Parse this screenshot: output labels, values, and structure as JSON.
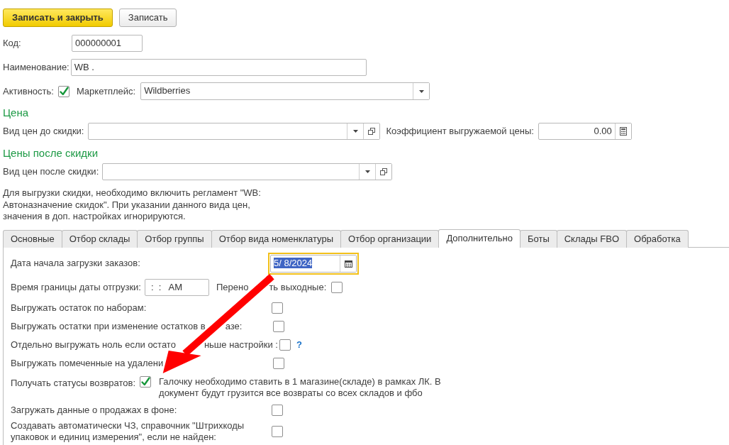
{
  "toolbar": {
    "buttons": [
      {
        "label": "Записать и закрыть",
        "kind": "primary"
      },
      {
        "label": "Записать",
        "kind": "default"
      }
    ]
  },
  "header": {
    "code": {
      "label": "Код:",
      "value": "000000001"
    },
    "name": {
      "label": "Наименование:",
      "value": "WB ."
    },
    "active": {
      "label": "Активность:",
      "checked": true
    },
    "marketplace": {
      "label": "Маркетплейс:",
      "value": "Wildberries"
    }
  },
  "price": {
    "title": "Цена",
    "price_type": {
      "label": "Вид цен до скидки:"
    },
    "coefficient": {
      "label": "Коэффициент выгружаемой цены:",
      "value": "0.00"
    }
  },
  "discount_price": {
    "title": "Цены после скидки",
    "price_type": {
      "label": "Вид цен после скидки:"
    },
    "note": "Для выгрузки скидки, необходимо включить регламент \"WB: Автоназначение скидок\". При указании данного вида цен, значения в доп. настройках игнорируются."
  },
  "tabs": [
    {
      "label": "Основные",
      "selected": false
    },
    {
      "label": "Отбор склады",
      "selected": false
    },
    {
      "label": "Отбор группы",
      "selected": false
    },
    {
      "label": "Отбор вида номенклатуры",
      "selected": false
    },
    {
      "label": "Отбор организации",
      "selected": false
    },
    {
      "label": "Дополнительно",
      "selected": true
    },
    {
      "label": "Боты",
      "selected": false
    },
    {
      "label": "Склады FBO",
      "selected": false
    },
    {
      "label": "Обработка",
      "selected": false
    }
  ],
  "settings": [
    {
      "kind": "date",
      "label": "Дата начала загрузки заказов:",
      "value": "5/ 8/2024",
      "focused": true
    },
    {
      "kind": "time",
      "label": "Время границы даты отгрузки:",
      "value": ":  :   AM",
      "option": {
        "label_parts": [
          "Перено",
          "ть выходные:"
        ],
        "checked": false
      }
    },
    {
      "kind": "checkbox",
      "label": "Выгружать остаток по наборам:",
      "checked": false
    },
    {
      "kind": "checkbox",
      "label_parts": [
        "Выгружать остатки при изменение остатков в",
        "азе:"
      ],
      "checked": false
    },
    {
      "kind": "checkbox",
      "label_parts": [
        "Отдельно выгружать ноль если остато",
        "ньше настройки :"
      ],
      "checked": false,
      "help": "?"
    },
    {
      "kind": "checkbox",
      "label_parts": [
        "Выгружать помеченные на удалени"
      ],
      "checked": false
    },
    {
      "kind": "inline_checkbox",
      "label": "Получать статусы возвратов:",
      "checked": true,
      "note": "Галочку необходимо ставить в 1 магазине(складе) в рамках ЛК. В документ будут грузится все возвраты со всех складов и фбо"
    },
    {
      "kind": "checkbox",
      "label": "Загружать данные о продажах в фоне:",
      "checked": false
    },
    {
      "kind": "checkbox",
      "label": "Создавать автоматически ЧЗ, справочник \"Штрихкоды упаковок и единиц измерения\", если не найден:",
      "checked": false
    }
  ]
}
